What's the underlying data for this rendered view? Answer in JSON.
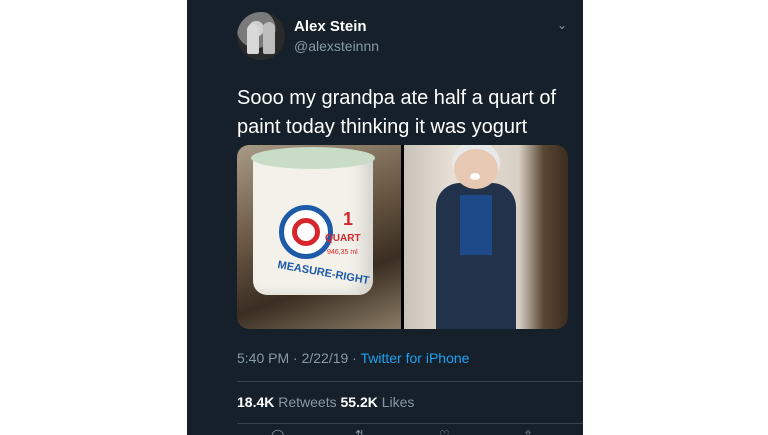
{
  "tweet": {
    "author_name": "Alex Stein",
    "author_handle": "@alexsteinnn",
    "text_line1": "Sooo my grandpa ate half a quart of",
    "text_line2": "paint today thinking it was yogurt",
    "timestamp": "5:40 PM · 2/22/19 · ",
    "source": "Twitter for iPhone",
    "retweets_count": "18.4K",
    "retweets_label": " Retweets ",
    "likes_count": "55.2K",
    "likes_label": " Likes"
  },
  "media": {
    "bucket_one": "1",
    "bucket_quart": "QUART",
    "bucket_ml": "946,35 ml",
    "bucket_brand": "MEASURE-RIGHT"
  },
  "icons": {
    "more": "chevron-down-icon",
    "reply": "reply-icon",
    "retweet": "retweet-icon",
    "like": "heart-icon",
    "share": "share-icon"
  },
  "colors": {
    "background": "#15202b",
    "link": "#1da1f2",
    "secondary_text": "#8899a6"
  }
}
